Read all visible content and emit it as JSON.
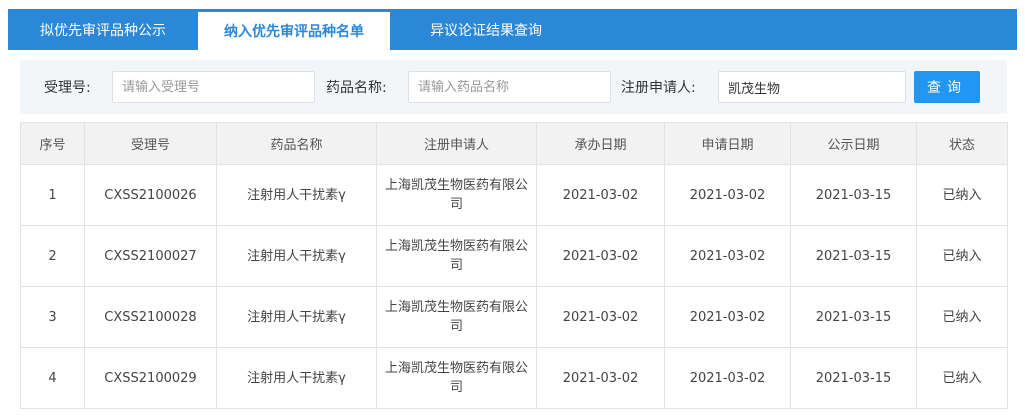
{
  "tabs": [
    {
      "label": "拟优先审评品种公示"
    },
    {
      "label": "纳入优先审评品种名单"
    },
    {
      "label": "异议论证结果查询"
    }
  ],
  "search": {
    "acceptance_no_label": "受理号:",
    "acceptance_no_placeholder": "请输入受理号",
    "drug_name_label": "药品名称:",
    "drug_name_placeholder": "请输入药品名称",
    "applicant_label": "注册申请人:",
    "applicant_value": "凯茂生物",
    "query_button": "查询"
  },
  "table": {
    "headers": [
      "序号",
      "受理号",
      "药品名称",
      "注册申请人",
      "承办日期",
      "申请日期",
      "公示日期",
      "状态"
    ],
    "rows": [
      {
        "no": "1",
        "acceptance_no": "CXSS2100026",
        "drug_name": "注射用人干扰素γ",
        "applicant": "上海凯茂生物医药有限公司",
        "handle_date": "2021-03-02",
        "apply_date": "2021-03-02",
        "publicity_date": "2021-03-15",
        "status": "已纳入"
      },
      {
        "no": "2",
        "acceptance_no": "CXSS2100027",
        "drug_name": "注射用人干扰素γ",
        "applicant": "上海凯茂生物医药有限公司",
        "handle_date": "2021-03-02",
        "apply_date": "2021-03-02",
        "publicity_date": "2021-03-15",
        "status": "已纳入"
      },
      {
        "no": "3",
        "acceptance_no": "CXSS2100028",
        "drug_name": "注射用人干扰素γ",
        "applicant": "上海凯茂生物医药有限公司",
        "handle_date": "2021-03-02",
        "apply_date": "2021-03-02",
        "publicity_date": "2021-03-15",
        "status": "已纳入"
      },
      {
        "no": "4",
        "acceptance_no": "CXSS2100029",
        "drug_name": "注射用人干扰素γ",
        "applicant": "上海凯茂生物医药有限公司",
        "handle_date": "2021-03-02",
        "apply_date": "2021-03-02",
        "publicity_date": "2021-03-15",
        "status": "已纳入"
      }
    ]
  },
  "colors": {
    "primary": "#2b88d8",
    "button": "#2196f3",
    "panel": "#f3f6f9",
    "header_bg": "#f2f2f2"
  }
}
